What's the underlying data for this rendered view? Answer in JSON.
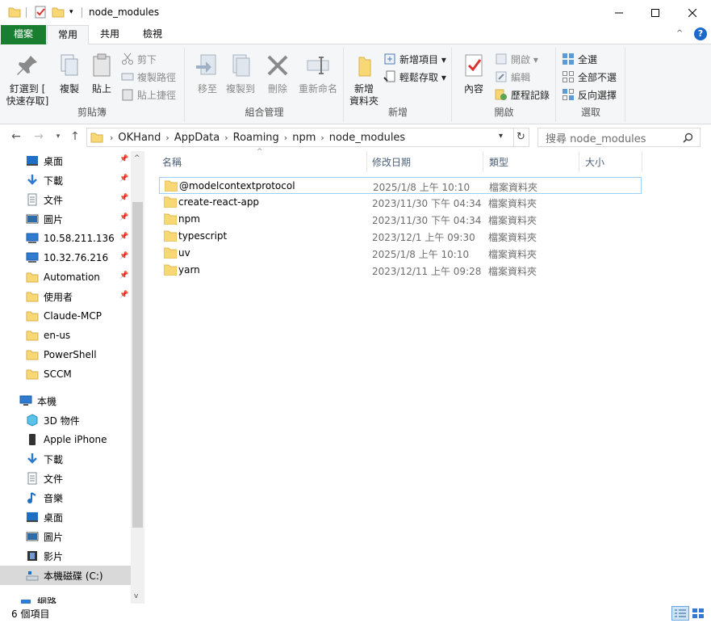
{
  "window": {
    "title": "node_modules",
    "minimize": "─",
    "maximize": "☐",
    "close": "✕"
  },
  "ribbon_tabs": [
    "檔案",
    "常用",
    "共用",
    "檢視"
  ],
  "ribbon": {
    "clipboard": {
      "label": "剪貼簿",
      "pin_line1": "釘選到 [",
      "pin_line2": "快速存取]",
      "copy": "複製",
      "paste": "貼上",
      "cut": "剪下",
      "copy_path": "複製路徑",
      "paste_shortcut": "貼上捷徑"
    },
    "organize": {
      "label": "組合管理",
      "move_to": "移至",
      "copy_to": "複製到",
      "delete": "刪除",
      "rename": "重新命名"
    },
    "new": {
      "label": "新增",
      "new_folder_line1": "新增",
      "new_folder_line2": "資料夾",
      "new_item": "新增項目 ▾",
      "easy_access": "輕鬆存取 ▾"
    },
    "open": {
      "label": "開啟",
      "properties": "內容",
      "open": "開啟 ▾",
      "edit": "編輯",
      "history": "歷程記錄"
    },
    "select": {
      "label": "選取",
      "select_all": "全選",
      "select_none": "全部不選",
      "invert": "反向選擇"
    }
  },
  "address": {
    "crumbs": [
      "OKHand",
      "AppData",
      "Roaming",
      "npm",
      "node_modules"
    ],
    "search_placeholder": "搜尋 node_modules"
  },
  "nav_pane": {
    "quick_access": [
      {
        "label": "桌面",
        "icon": "desktop-icon",
        "pinned": true
      },
      {
        "label": "下載",
        "icon": "download-icon",
        "pinned": true
      },
      {
        "label": "文件",
        "icon": "document-icon",
        "pinned": true
      },
      {
        "label": "圖片",
        "icon": "pictures-icon",
        "pinned": true
      },
      {
        "label": "10.58.211.136",
        "icon": "network-drive-icon",
        "pinned": true
      },
      {
        "label": "10.32.76.216",
        "icon": "network-drive-icon",
        "pinned": true
      },
      {
        "label": "Automation",
        "icon": "folder-icon",
        "pinned": true
      },
      {
        "label": "使用者",
        "icon": "folder-icon",
        "pinned": true
      },
      {
        "label": "Claude-MCP",
        "icon": "folder-icon",
        "pinned": false
      },
      {
        "label": "en-us",
        "icon": "folder-icon",
        "pinned": false
      },
      {
        "label": "PowerShell",
        "icon": "folder-icon",
        "pinned": false
      },
      {
        "label": "SCCM",
        "icon": "folder-icon",
        "pinned": false
      }
    ],
    "this_pc": "本機",
    "pc_items": [
      {
        "label": "3D 物件",
        "icon": "3d-objects-icon"
      },
      {
        "label": "Apple iPhone",
        "icon": "phone-icon"
      },
      {
        "label": "下載",
        "icon": "download-icon"
      },
      {
        "label": "文件",
        "icon": "document-icon"
      },
      {
        "label": "音樂",
        "icon": "music-icon"
      },
      {
        "label": "桌面",
        "icon": "desktop-icon"
      },
      {
        "label": "圖片",
        "icon": "pictures-icon"
      },
      {
        "label": "影片",
        "icon": "video-icon"
      },
      {
        "label": "本機磁碟 (C:)",
        "icon": "drive-icon"
      }
    ],
    "network": "網路"
  },
  "columns": [
    "名稱",
    "修改日期",
    "類型",
    "大小"
  ],
  "files": [
    {
      "name": "@modelcontextprotocol",
      "date": "2025/1/8 上午 10:10",
      "type": "檔案資料夾"
    },
    {
      "name": "create-react-app",
      "date": "2023/11/30 下午 04:34",
      "type": "檔案資料夾"
    },
    {
      "name": "npm",
      "date": "2023/11/30 下午 04:34",
      "type": "檔案資料夾"
    },
    {
      "name": "typescript",
      "date": "2023/12/1 上午 09:30",
      "type": "檔案資料夾"
    },
    {
      "name": "uv",
      "date": "2025/1/8 上午 10:10",
      "type": "檔案資料夾"
    },
    {
      "name": "yarn",
      "date": "2023/12/11 上午 09:28",
      "type": "檔案資料夾"
    }
  ],
  "status": {
    "count": "6 個項目"
  },
  "colors": {
    "file_tab": "#1a7e30",
    "folder": "#f8d775",
    "selection_border": "#99d1ff",
    "header_text": "#4c607a"
  }
}
